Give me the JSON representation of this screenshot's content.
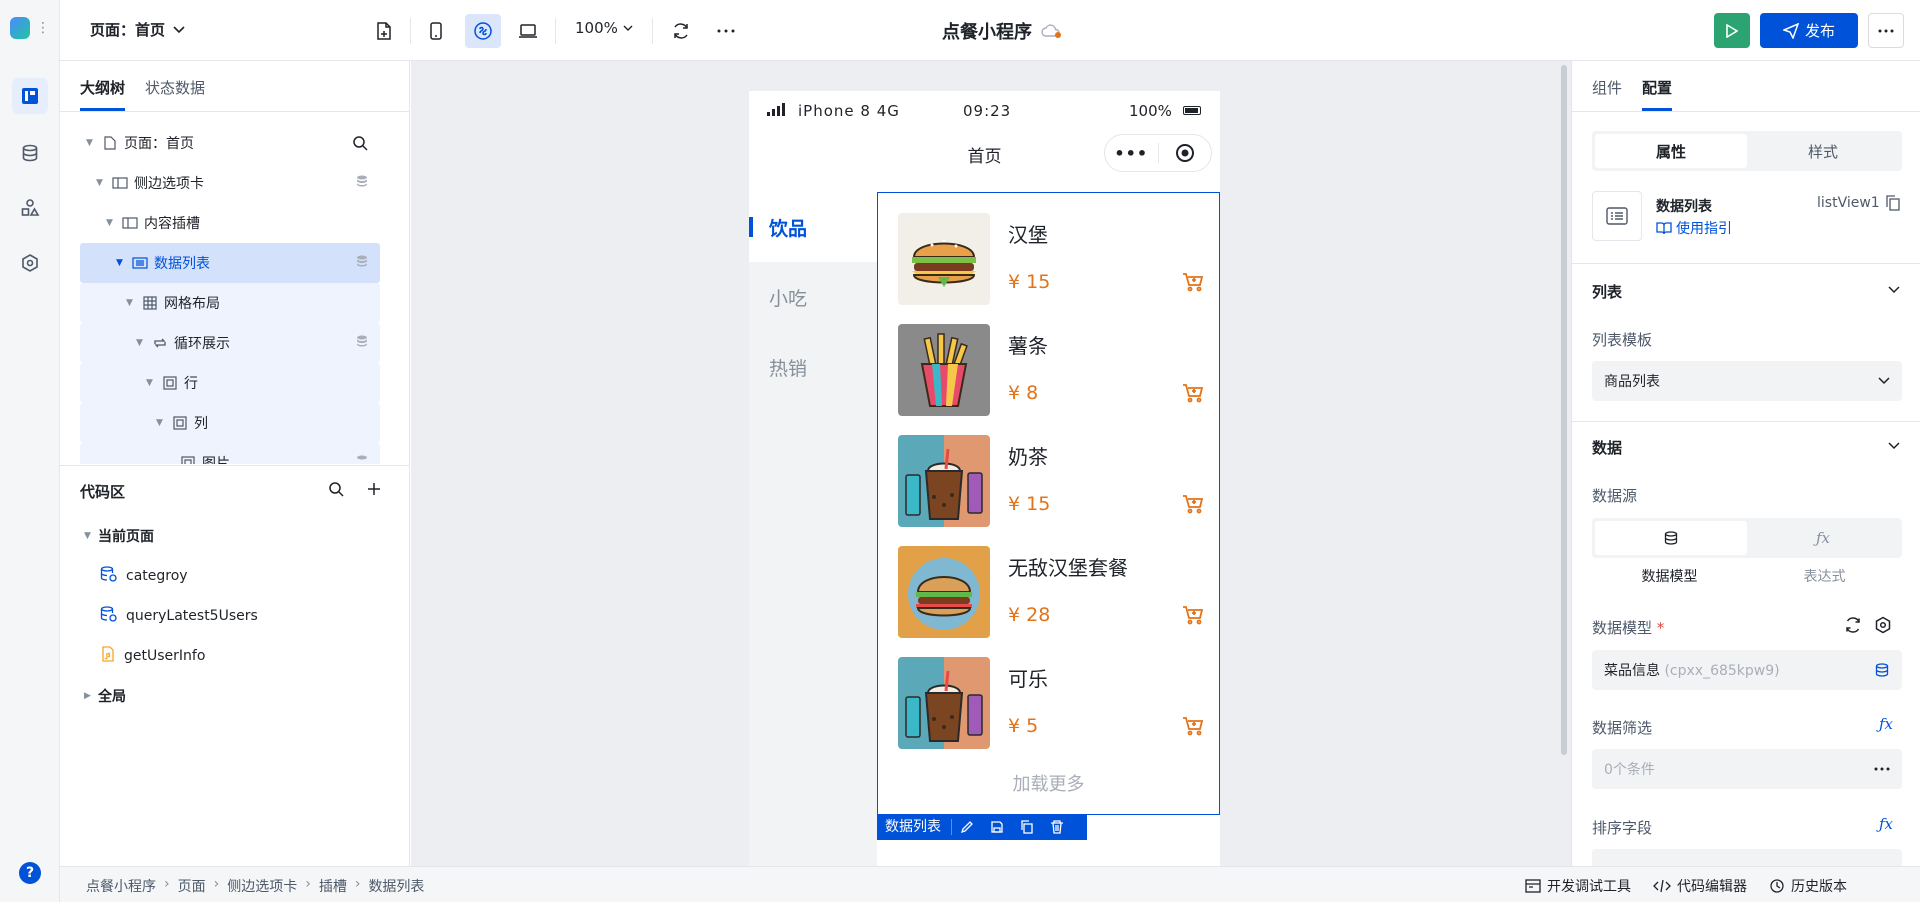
{
  "topbar": {
    "page_selector": "页面：首页",
    "zoom": "100%",
    "app_title": "点餐小程序",
    "publish_label": "发布"
  },
  "left_panel": {
    "tabs": [
      {
        "label": "大纲树"
      },
      {
        "label": "状态数据"
      }
    ],
    "tree": [
      {
        "label": "页面：首页"
      },
      {
        "label": "侧边选项卡"
      },
      {
        "label": "内容插槽"
      },
      {
        "label": "数据列表"
      },
      {
        "label": "网格布局"
      },
      {
        "label": "循环展示"
      },
      {
        "label": "行"
      },
      {
        "label": "列"
      },
      {
        "label": "图片"
      }
    ],
    "code": {
      "title": "代码区",
      "current_page": "当前页面",
      "items": [
        {
          "label": "categroy"
        },
        {
          "label": "queryLatest5Users"
        },
        {
          "label": "getUserInfo"
        }
      ],
      "global": "全局"
    }
  },
  "phone": {
    "carrier": "iPhone 8  4G",
    "time": "09:23",
    "battery": "100%",
    "nav_title": "首页",
    "side_tabs": [
      {
        "label": "饮品"
      },
      {
        "label": "小吃"
      },
      {
        "label": "热销"
      }
    ],
    "items": [
      {
        "name": "汉堡",
        "price": "¥ 15"
      },
      {
        "name": "薯条",
        "price": "¥ 8"
      },
      {
        "name": "奶茶",
        "price": "¥ 15"
      },
      {
        "name": "无敌汉堡套餐",
        "price": "¥ 28"
      },
      {
        "name": "可乐",
        "price": "¥ 5"
      }
    ],
    "load_more": "加载更多",
    "selection_label": "数据列表"
  },
  "bottombar": {
    "breadcrumb": [
      "点餐小程序",
      "页面",
      "侧边选项卡",
      "插槽",
      "数据列表"
    ],
    "dev_tools": "开发调试工具",
    "code_editor": "代码编辑器",
    "history": "历史版本"
  },
  "right_panel": {
    "tabs": [
      {
        "label": "组件"
      },
      {
        "label": "配置"
      }
    ],
    "seg": [
      "属性",
      "样式"
    ],
    "component": {
      "name": "数据列表",
      "guide": "使用指引",
      "id": "listView1"
    },
    "list_section": {
      "title": "列表",
      "template_label": "列表模板",
      "template_value": "商品列表"
    },
    "data_section": {
      "title": "数据",
      "source_label": "数据源",
      "source_options": [
        "数据模型",
        "表达式"
      ],
      "model_label": "数据模型",
      "model_name": "菜品信息",
      "model_code": "(cpxx_685kpw9)",
      "filter_label": "数据筛选",
      "filter_value": "0个条件",
      "sort_label": "排序字段"
    }
  },
  "colors": {
    "primary": "#0052d9",
    "price": "#e37318",
    "run": "#2ba471"
  }
}
